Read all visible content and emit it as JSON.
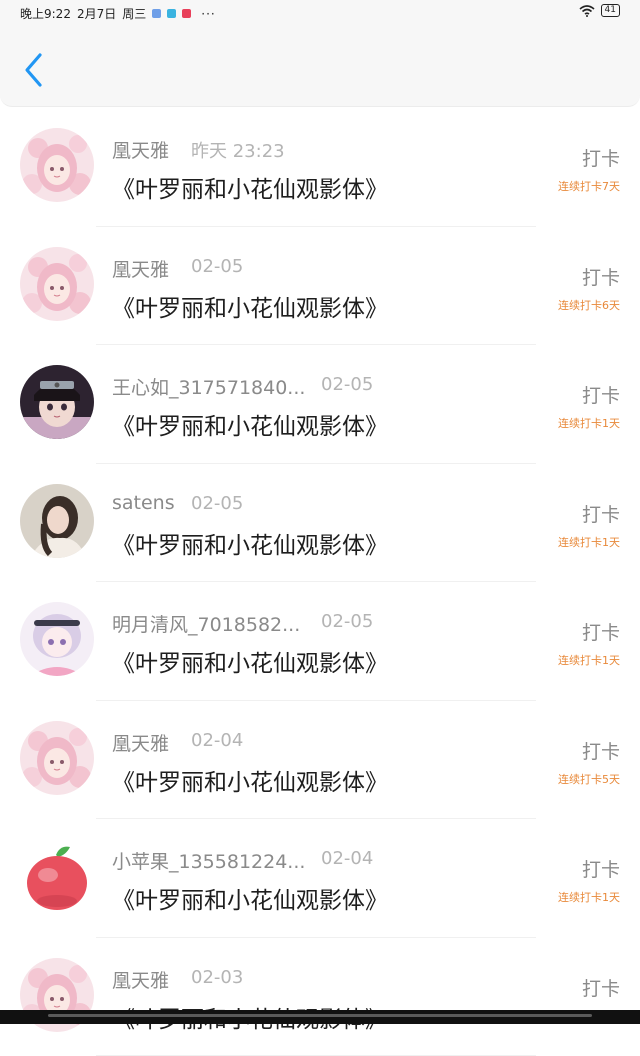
{
  "status_bar": {
    "time": "晚上9:22",
    "date": "2月7日",
    "weekday": "周三",
    "more_icon": "···",
    "battery": "41"
  },
  "header": {
    "back_icon": "chevron-left-icon"
  },
  "list": [
    {
      "name": "凰天雅",
      "date": "昨天 23:23",
      "title": "《叶罗丽和小花仙观影体》",
      "checkin": "打卡",
      "streak": "连续打卡7天",
      "avatar": "pink-anime-girl"
    },
    {
      "name": "凰天雅",
      "date": "02-05",
      "title": "《叶罗丽和小花仙观影体》",
      "checkin": "打卡",
      "streak": "连续打卡6天",
      "avatar": "pink-anime-girl"
    },
    {
      "name": "王心如_317571840...",
      "date": "02-05",
      "title": "《叶罗丽和小花仙观影体》",
      "checkin": "打卡",
      "streak": "连续打卡1天",
      "avatar": "ninja-girl"
    },
    {
      "name": "satens",
      "date": "02-05",
      "title": "《叶罗丽和小花仙观影体》",
      "checkin": "打卡",
      "streak": "连续打卡1天",
      "avatar": "long-hair-girl"
    },
    {
      "name": "明月清风_7018582...",
      "date": "02-05",
      "title": "《叶罗丽和小花仙观影体》",
      "checkin": "打卡",
      "streak": "连续打卡1天",
      "avatar": "lavender-anime-girl"
    },
    {
      "name": "凰天雅",
      "date": "02-04",
      "title": "《叶罗丽和小花仙观影体》",
      "checkin": "打卡",
      "streak": "连续打卡5天",
      "avatar": "pink-anime-girl"
    },
    {
      "name": "小苹果_135581224...",
      "date": "02-04",
      "title": "《叶罗丽和小花仙观影体》",
      "checkin": "打卡",
      "streak": "连续打卡1天",
      "avatar": "apple"
    },
    {
      "name": "凰天雅",
      "date": "02-03",
      "title": "《叶罗丽和小花仙观影体》",
      "checkin": "打卡",
      "streak": "",
      "avatar": "pink-anime-girl"
    }
  ]
}
